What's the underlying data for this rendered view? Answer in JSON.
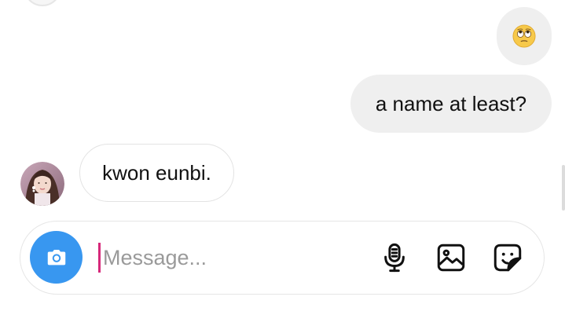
{
  "thread": {
    "sent_emoji": "🙄",
    "sent_message": "a name at least?",
    "received_message": "kwon eunbi."
  },
  "composer": {
    "placeholder": "Message..."
  },
  "icons": {
    "camera": "camera-icon",
    "microphone": "microphone-icon",
    "gallery": "gallery-icon",
    "sticker": "sticker-icon"
  },
  "colors": {
    "accent": "#3897f0",
    "bubble": "#efefef",
    "caret": "#d6287a"
  }
}
